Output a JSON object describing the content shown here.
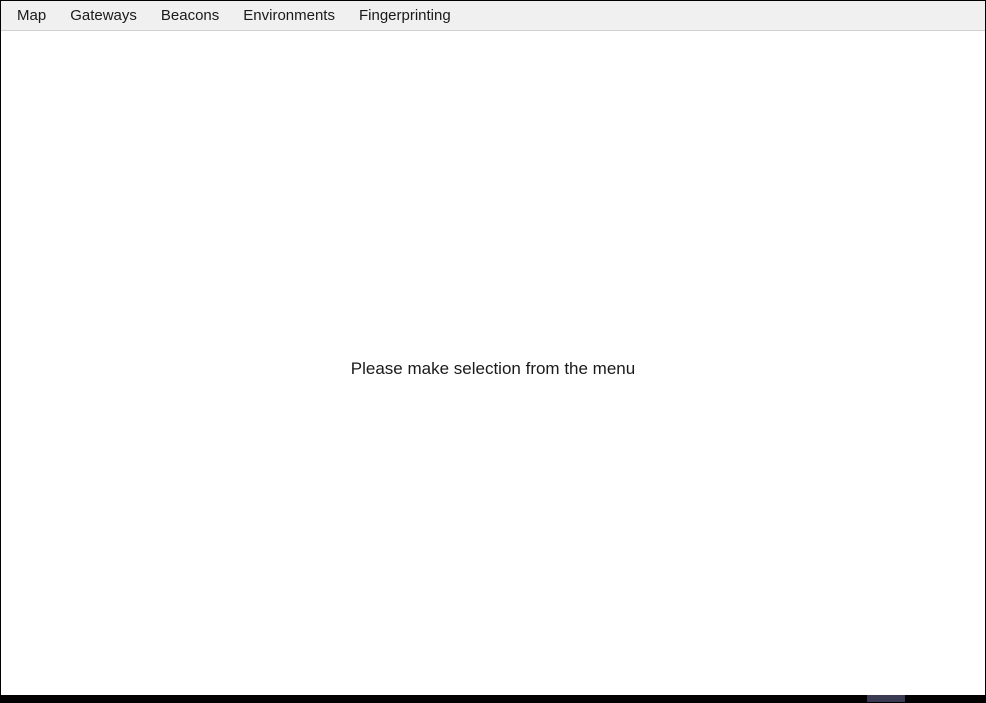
{
  "menu": {
    "items": [
      "Map",
      "Gateways",
      "Beacons",
      "Environments",
      "Fingerprinting"
    ]
  },
  "content": {
    "placeholder": "Please make selection from the menu"
  }
}
